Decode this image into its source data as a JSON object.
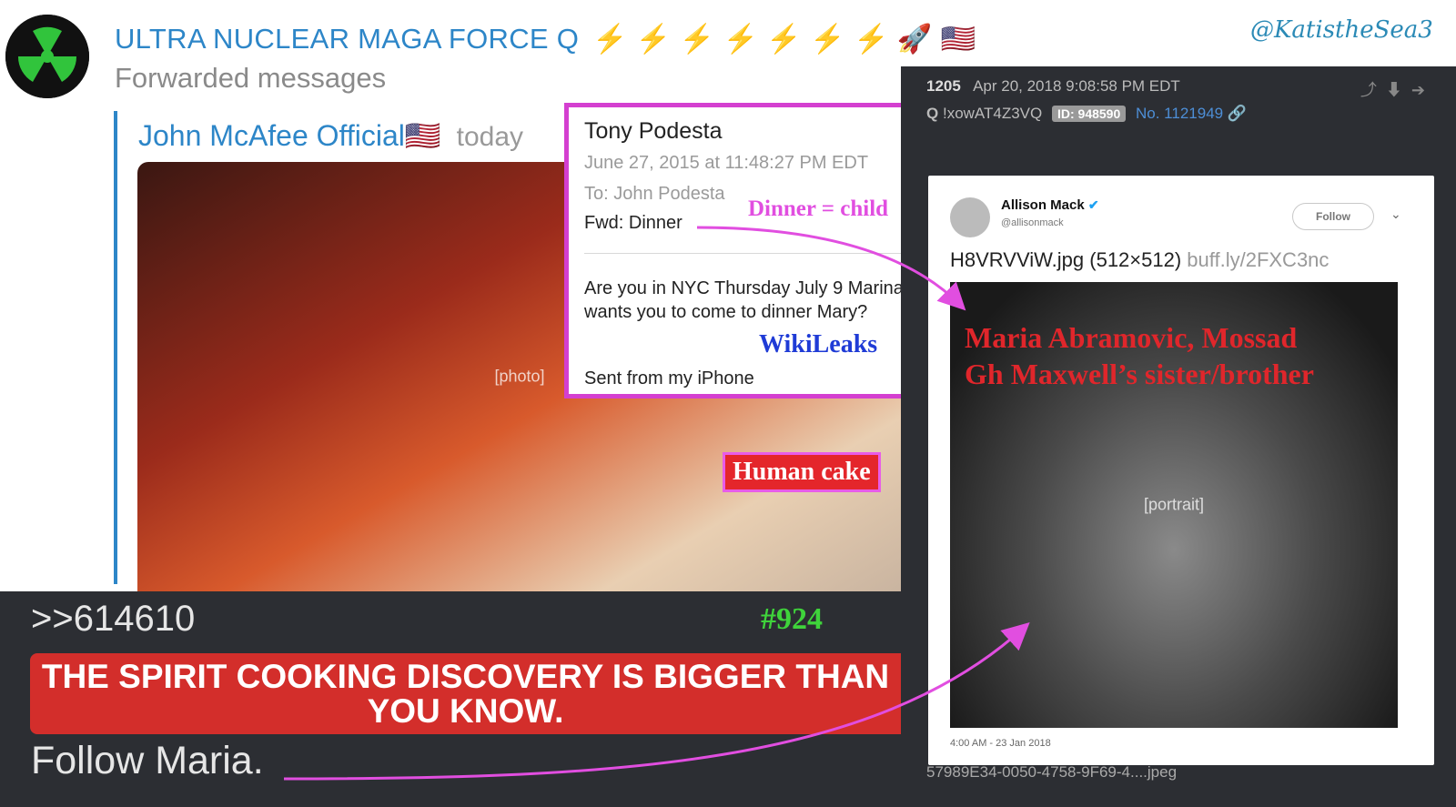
{
  "header": {
    "channel_title": "ULTRA NUCLEAR MAGA FORCE Q",
    "channel_emojis": "⚡ ⚡ ⚡ ⚡ ⚡ ⚡ ⚡ 🚀 🇺🇸",
    "subtitle": "Forwarded messages",
    "forwarded_from": "John McAfee Official🇺🇸",
    "forwarded_time": "today",
    "watermark": "@KatistheSea3"
  },
  "photo_label": "Human cake",
  "email": {
    "from": "Tony Podesta",
    "date": "June 27, 2015 at 11:48:27 PM EDT",
    "to": "To: John Podesta",
    "subject": "Fwd: Dinner",
    "annotation": "Dinner = child",
    "body": "Are you in NYC Thursday July 9 Marina wants you to come to dinner Mary?",
    "source_label": "WikiLeaks",
    "signature": "Sent from my iPhone"
  },
  "bottom_post": {
    "reply_ref": ">>614610",
    "post_number": "#924",
    "banner": "THE SPIRIT COOKING DISCOVERY IS BIGGER THAN YOU KNOW.",
    "follow_text": "Follow Maria."
  },
  "q_post": {
    "index": "1205",
    "timestamp": "Apr 20, 2018 9:08:58 PM EDT",
    "q_label": "Q",
    "tripcode": "!xowAT4Z3VQ",
    "id_badge": "ID: 948590",
    "post_no": "No. 1121949",
    "filename": "57989E34-0050-4758-9F69-4....jpeg"
  },
  "tweet": {
    "name": "Allison Mack",
    "handle": "@allisonmack",
    "follow_label": "Follow",
    "text_file": "H8VRVViW.jpg (512×512)",
    "text_link": "buff.ly/2FXC3nc",
    "overlay_line1": "Maria Abramovic, Mossad",
    "overlay_line2": "Gh Maxwell’s sister/brother",
    "time": "4:00 AM - 23 Jan 2018"
  },
  "colors": {
    "telegram_blue": "#2d86c8",
    "banner_red": "#d32e2b",
    "annotation_magenta": "#e14ee0",
    "post_bg": "#2c2e33"
  }
}
